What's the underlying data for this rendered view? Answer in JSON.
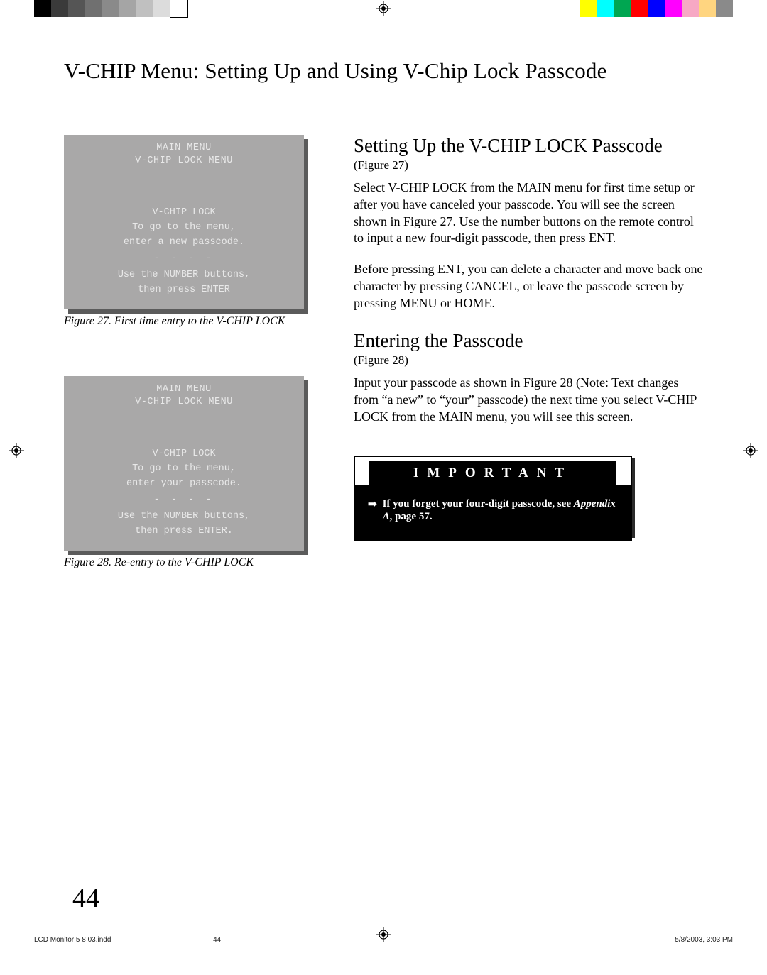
{
  "colorbars": {
    "left": [
      "#000000",
      "#3a3a3a",
      "#555555",
      "#707070",
      "#8a8a8a",
      "#a5a5a5",
      "#c0c0c0",
      "#dcdcdc",
      "#ffffff"
    ],
    "right": [
      "#ffff00",
      "#00ffff",
      "#00a651",
      "#ff0000",
      "#0000ff",
      "#ff00ff",
      "#f7a8c4",
      "#ffd580",
      "#8a8a8a"
    ]
  },
  "title": "V-CHIP Menu:  Setting Up and Using V-Chip Lock Passcode",
  "figures": {
    "f27": {
      "hdr1": "MAIN MENU",
      "hdr2": "V-CHIP LOCK MENU",
      "l1": "V-CHIP LOCK",
      "l2": "To go to the menu,",
      "l3": "enter a new passcode.",
      "dashes": "- - - -",
      "l4": "Use the NUMBER buttons,",
      "l5": "then press ENTER",
      "caption": "Figure 27.  First time entry to the V-CHIP LOCK"
    },
    "f28": {
      "hdr1": "MAIN MENU",
      "hdr2": "V-CHIP LOCK MENU",
      "l1": "V-CHIP LOCK",
      "l2": "To go to the menu,",
      "l3": "enter your passcode.",
      "dashes": "- - - -",
      "l4": "Use the NUMBER buttons,",
      "l5": "then press ENTER.",
      "caption": "Figure 28. Re-entry to the V-CHIP LOCK"
    }
  },
  "section1": {
    "heading": "Setting Up the V-CHIP LOCK Passcode",
    "figref": "(Figure 27)",
    "p1": "Select V-CHIP LOCK from the MAIN menu for first time setup or after you have canceled your passcode. You will see the screen shown in Figure 27.  Use the number buttons on the remote control to input a new four-digit passcode, then press ENT.",
    "p2": "Before pressing ENT, you can delete a character and move back one character by pressing CANCEL, or leave the passcode screen by pressing  MENU or HOME."
  },
  "section2": {
    "heading": "Entering the Passcode",
    "figref": "(Figure 28)",
    "p1": "Input your passcode as shown in Figure 28 (Note: Text changes from “a new” to “your” passcode) the next time you select V-CHIP LOCK from the MAIN menu, you will see this screen."
  },
  "important": {
    "head": "IMPORTANT",
    "text_prefix": "If you forget your four-digit passcode, see ",
    "text_em": "Appendix A",
    "text_suffix": ", page 57."
  },
  "pagenum": "44",
  "footer": {
    "file": "LCD Monitor 5 8 03.indd",
    "page": "44",
    "datetime": "5/8/2003, 3:03 PM"
  }
}
